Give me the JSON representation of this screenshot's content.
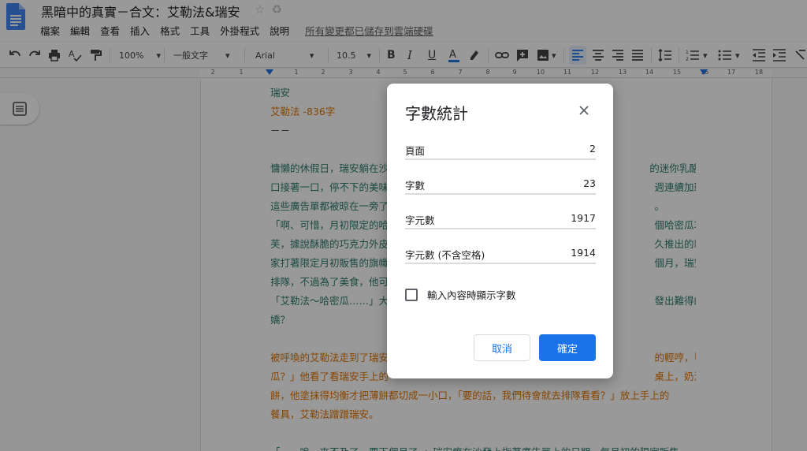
{
  "app": {
    "title": "黑暗中的真實－合文：艾勒法&瑞安",
    "menu": [
      "檔案",
      "編輯",
      "查看",
      "插入",
      "格式",
      "工具",
      "外掛程式",
      "說明"
    ],
    "save_status": "所有變更都已儲存到雲端硬碟"
  },
  "toolbar": {
    "zoom": "100%",
    "style": "一般文字",
    "font": "Arial",
    "size": "10.5"
  },
  "ruler": {
    "numbers": [
      "2",
      "1",
      "1",
      "2",
      "3",
      "4",
      "5",
      "6",
      "7",
      "8",
      "9",
      "10",
      "11",
      "12",
      "13",
      "14",
      "15",
      "16",
      "17",
      "18"
    ]
  },
  "document": {
    "lines": [
      {
        "text": "瑞安",
        "color": "#2e7d6b"
      },
      {
        "text": "艾勒法 -836字",
        "color": "#e37400"
      },
      {
        "text": "－－",
        "color": "#3c4043"
      },
      {
        "text": "",
        "color": "#2e7d6b"
      },
      {
        "text": "慵懶的休假日，瑞安躺在沙發上，　　　　　　　　　　　　　　　　　　　　　　　　的迷你乳酪酥，一",
        "color": "#2e7d6b"
      },
      {
        "text": "口接著一口，停不下的美味　　　　　　　　　　　　　　　　　　　　　　　　　　　週連續加班，使得",
        "color": "#2e7d6b"
      },
      {
        "text": "這些廣告單都被晾在一旁了　　　　　　　　　　　　　　　　　　　　　　　　　　　。",
        "color": "#2e7d6b"
      },
      {
        "text": "「啊、可惜，月初限定的哈　　　　　　　　　　　　　　　　　　　　　　　　　　　個哈密瓜巧克力泡",
        "color": "#2e7d6b"
      },
      {
        "text": "芙，據說酥脆的巧克力外皮　　　　　　　　　　　　　　　　　　　　　　　　　　　久推出的新品，店",
        "color": "#2e7d6b"
      },
      {
        "text": "家打著限定月初販售的旗幟　　　　　　　　　　　　　　　　　　　　　　　　　　　個月，瑞安不喜歡",
        "color": "#2e7d6b"
      },
      {
        "text": "排隊，不過為了美食，他可　　　　　　　　　　　　　　　　　　　　　　　　　　　",
        "color": "#2e7d6b"
      },
      {
        "text": "「艾勒法～哈密瓜……」大　　　　　　　　　　　　　　　　　　　　　　　　　　　發出難得的……撒",
        "color": "#2e7d6b"
      },
      {
        "text": "嬌？",
        "color": "#2e7d6b"
      },
      {
        "text": "",
        "color": "#2e7d6b"
      },
      {
        "text": "被呼喚的艾勒法走到了瑞安　　　　　　　　　　　　　　　　　　　　　　　　　　　的輕哼，「哈蜜",
        "color": "#e37400"
      },
      {
        "text": "瓜？」他看了看瑞安手上的　　　　　　　　　　　　　　　　　　　　　　　　　　　桌上，奶油搭上鬆",
        "color": "#e37400"
      },
      {
        "text": "餅，他塗抹得均衡才把薄餅都切成一小口，「要的話，我們待會就去排隊看看？」放上手上的",
        "color": "#e37400"
      },
      {
        "text": "餐具，艾勒法蹭蹭瑞安。",
        "color": "#e37400"
      },
      {
        "text": "",
        "color": "#2e7d6b"
      },
      {
        "text": "「……嗚、來不及了，要下個月了。」瑞安癱在沙發上指著廣告單上的日期，每月初的限定販售",
        "color": "#2e7d6b"
      }
    ]
  },
  "dialog": {
    "title": "字數統計",
    "stats": [
      {
        "label": "頁面",
        "value": "2"
      },
      {
        "label": "字數",
        "value": "23"
      },
      {
        "label": "字元數",
        "value": "1917"
      },
      {
        "label": "字元數 (不含空格)",
        "value": "1914"
      }
    ],
    "checkbox_label": "輸入內容時顯示字數",
    "checkbox_checked": false,
    "cancel_label": "取消",
    "ok_label": "確定"
  },
  "colors": {
    "accent": "#1a73e8",
    "doc_green": "#2e7d6b",
    "doc_orange": "#e37400"
  },
  "icons": [
    "docs-logo-icon",
    "star-icon",
    "move-to-drive-icon",
    "undo-icon",
    "redo-icon",
    "print-icon",
    "spellcheck-icon",
    "paint-format-icon",
    "bold-icon",
    "italic-icon",
    "underline-icon",
    "text-color-icon",
    "highlight-icon",
    "link-icon",
    "comment-icon",
    "image-icon",
    "align-left-icon",
    "align-center-icon",
    "align-right-icon",
    "justify-icon",
    "line-spacing-icon",
    "numbered-list-icon",
    "bulleted-list-icon",
    "decrease-indent-icon",
    "increase-indent-icon",
    "clear-format-icon",
    "outline-icon",
    "close-icon"
  ]
}
